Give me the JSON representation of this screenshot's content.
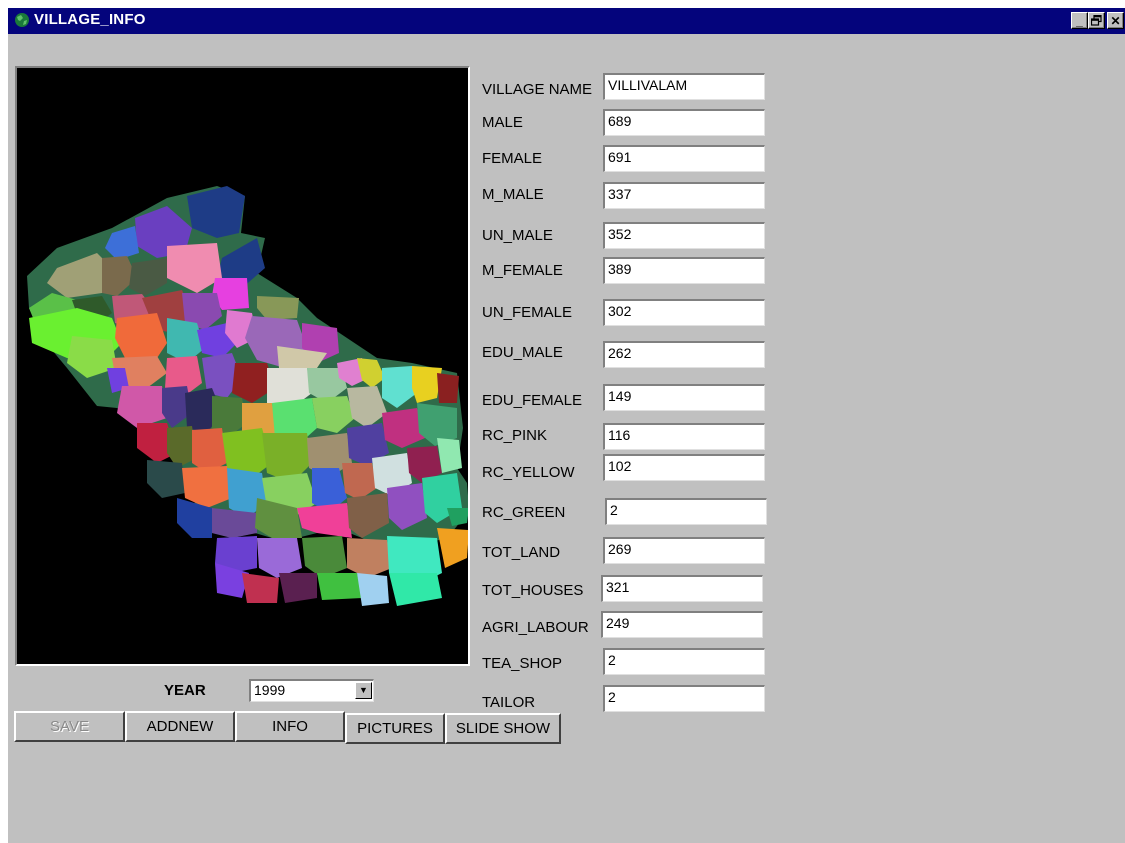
{
  "window": {
    "title": "VILLAGE_INFO",
    "controls": {
      "minimize": "_",
      "restore": "🗗",
      "close": "✕"
    },
    "background": "#c0c0c0",
    "titlebar_color": "#04047c"
  },
  "map": {
    "background": "#000000",
    "icon_name": "village-map-image"
  },
  "fields": [
    {
      "label": "VILLAGE NAME",
      "value": "VILLIVALAM"
    },
    {
      "label": "MALE",
      "value": "689"
    },
    {
      "label": "FEMALE",
      "value": "691"
    },
    {
      "label": "M_MALE",
      "value": "337"
    },
    {
      "label": "UN_MALE",
      "value": "352"
    },
    {
      "label": "M_FEMALE",
      "value": "389"
    },
    {
      "label": "UN_FEMALE",
      "value": "302"
    },
    {
      "label": "EDU_MALE",
      "value": "262"
    },
    {
      "label": "EDU_FEMALE",
      "value": "149"
    },
    {
      "label": "RC_PINK",
      "value": "116"
    },
    {
      "label": "RC_YELLOW",
      "value": "102"
    },
    {
      "label": "RC_GREEN",
      "value": "2"
    },
    {
      "label": "TOT_LAND",
      "value": "269"
    },
    {
      "label": "TOT_HOUSES",
      "value": "321"
    },
    {
      "label": "AGRI_LABOUR",
      "value": "249"
    },
    {
      "label": "TEA_SHOP",
      "value": "2"
    },
    {
      "label": "TAILOR",
      "value": "2"
    }
  ],
  "year": {
    "label": "YEAR",
    "value": "1999"
  },
  "buttons": {
    "save": "SAVE",
    "addnew": "ADDNEW",
    "info": "INFO",
    "pictures": "PICTURES",
    "slideshow": "SLIDE SHOW"
  }
}
